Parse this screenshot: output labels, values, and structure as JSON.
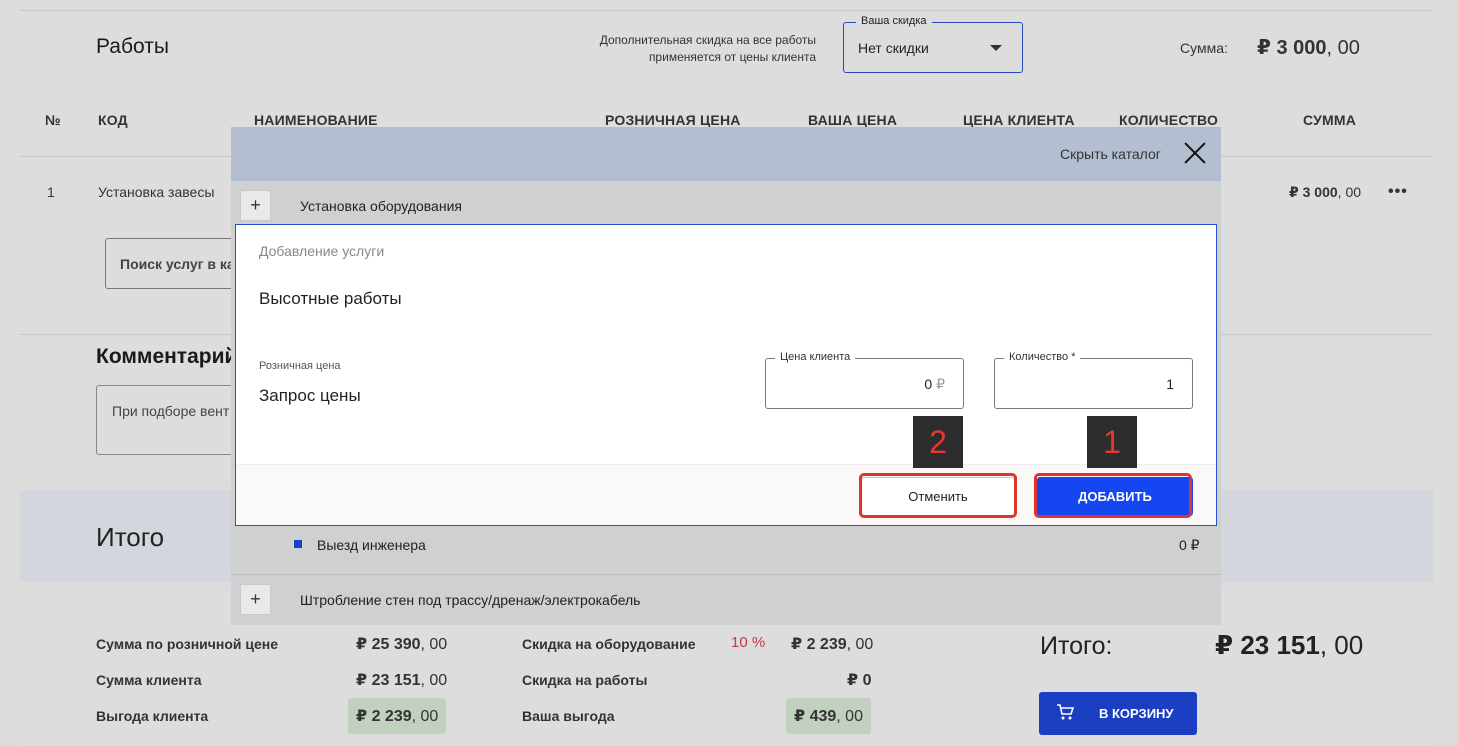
{
  "works": {
    "title": "Работы",
    "discount_note_line1": "Дополнительная скидка на все работы",
    "discount_note_line2": "применяется от цены клиента",
    "discount_legend": "Ваша скидка",
    "discount_value": "Нет скидки",
    "sum_label": "Сумма:",
    "sum_value_main": "₽ 3 000",
    "sum_value_cents": ", 00",
    "columns": [
      "№",
      "КОД",
      "НАИМЕНОВАНИЕ",
      "РОЗНИЧНАЯ ЦЕНА",
      "ВАША ЦЕНА",
      "ЦЕНА КЛИЕНТА",
      "КОЛИЧЕСТВО",
      "СУММА"
    ],
    "row": {
      "num": "1",
      "name": "Установка завесы",
      "sum_main": "₽ 3 000",
      "sum_cents": ", 00",
      "menu": "•••"
    },
    "search_placeholder": "Поиск услуг в ка",
    "comment_title": "Комментарий",
    "comment_text": "При подборе вент"
  },
  "total": {
    "title": "Итого",
    "retail_label": "Сумма по розничной цене",
    "retail_main": "₽ 25 390",
    "retail_cents": ", 00",
    "client_label": "Сумма клиента",
    "client_main": "₽ 23 151",
    "client_cents": ", 00",
    "benefit_label": "Выгода клиента",
    "benefit_main": "₽ 2 239",
    "benefit_cents": ", 00",
    "equip_discount_label": "Скидка на оборудование",
    "equip_discount_pct": "10 %",
    "equip_discount_main": "₽ 2 239",
    "equip_discount_cents": ", 00",
    "works_discount_label": "Скидка на работы",
    "works_discount_value": "₽ 0",
    "your_benefit_label": "Ваша выгода",
    "your_benefit_main": "₽ 439",
    "your_benefit_cents": ", 00",
    "grand_label": "Итого:",
    "grand_main": "₽ 23 151",
    "grand_cents": ", 00",
    "cart_button": "В КОРЗИНУ"
  },
  "catalog": {
    "hide_label": "Скрыть каталог",
    "plus": "+",
    "group1": "Установка оборудования",
    "item_engineer": "Выезд инженера",
    "item_engineer_price": "0 ₽",
    "group2": "Штробление стен под трассу/дренаж/электрокабель"
  },
  "dialog": {
    "caption": "Добавление услуги",
    "title": "Высотные работы",
    "retail_label": "Розничная цена",
    "retail_value": "Запрос цены",
    "client_price_legend": "Цена клиента",
    "client_price_value": "0",
    "client_price_unit": "₽",
    "qty_legend": "Количество *",
    "qty_value": "1",
    "cancel_label": "Отменить",
    "add_label": "ДОБАВИТЬ"
  },
  "annotations": {
    "badge_add": "1",
    "badge_cancel": "2"
  },
  "colors": {
    "accent": "#1446f2",
    "annotation": "#e0342b",
    "badge_bg": "#2d2d2d"
  }
}
